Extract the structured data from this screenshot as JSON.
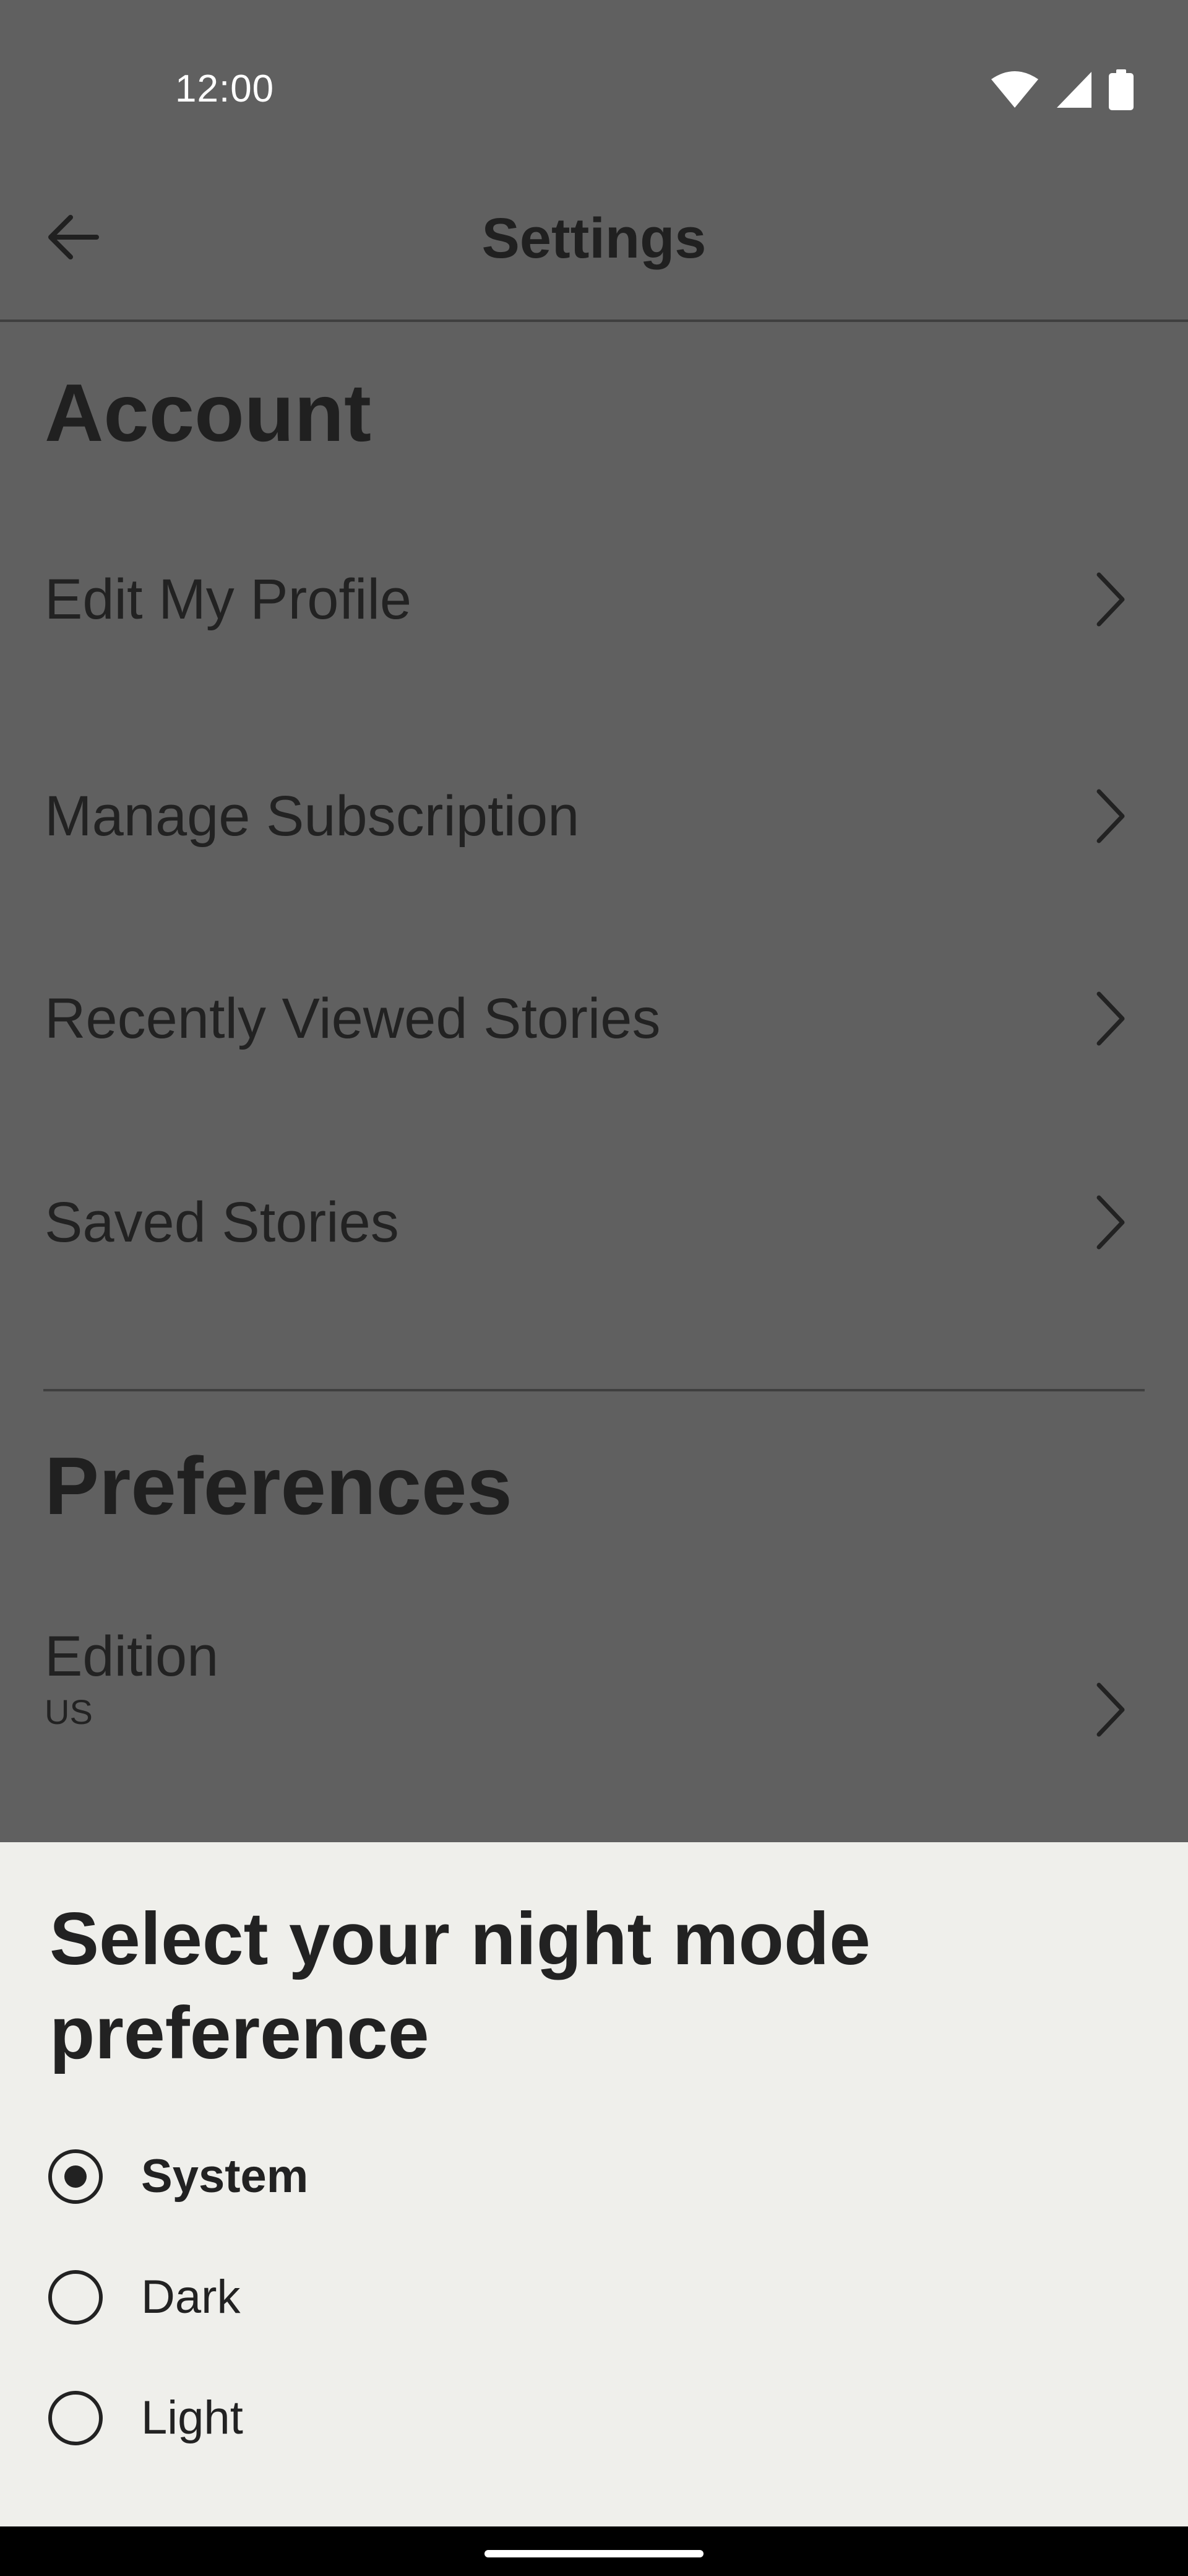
{
  "status_bar": {
    "time": "12:00",
    "icons": [
      "wifi-icon",
      "signal-icon",
      "battery-icon"
    ]
  },
  "app_bar": {
    "title": "Settings",
    "back_icon": "arrow-left-icon"
  },
  "account": {
    "heading": "Account",
    "items": [
      {
        "label": "Edit My Profile"
      },
      {
        "label": "Manage Subscription"
      },
      {
        "label": "Recently Viewed Stories"
      },
      {
        "label": "Saved Stories"
      }
    ]
  },
  "preferences": {
    "heading": "Preferences",
    "items": [
      {
        "label": "Edition",
        "value": "US"
      }
    ]
  },
  "night_mode_sheet": {
    "title": "Select your night mode preference",
    "options": [
      {
        "label": "System",
        "selected": true
      },
      {
        "label": "Dark",
        "selected": false
      },
      {
        "label": "Light",
        "selected": false
      }
    ]
  },
  "colors": {
    "scrim_background": "#606060",
    "sheet_background": "#efefeb",
    "text": "#222222",
    "divider": "#3f3f3f"
  }
}
